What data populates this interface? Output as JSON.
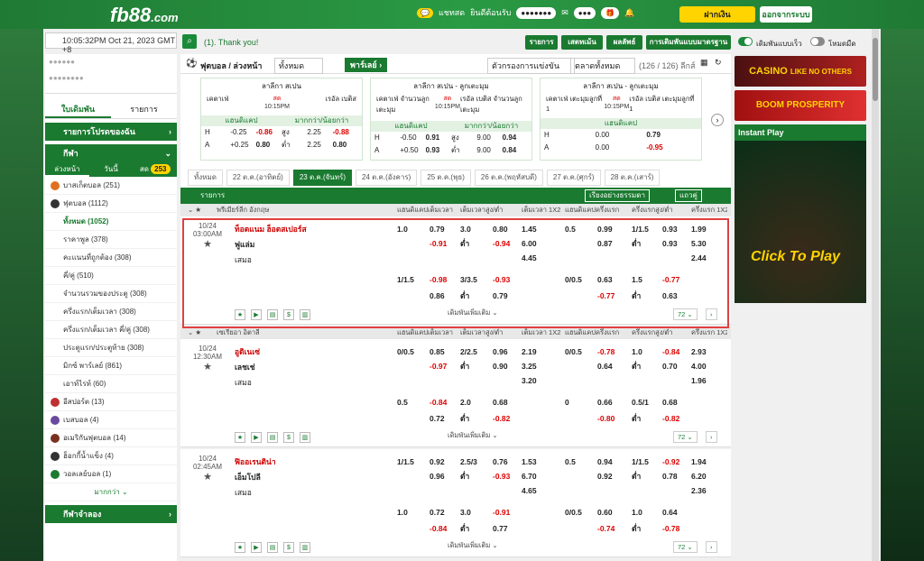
{
  "header": {
    "logo": "fb88",
    "logo_suffix": ".com",
    "chat": "แชทสด",
    "welcome": "ยินดีต้อนรับ",
    "deposit": "ฝากเงิน",
    "logout": "ออกจากระบบ"
  },
  "toolbar": {
    "datetime": "10:05:32PM Oct 21, 2023 GMT +8",
    "marquee": "(1). Thank you!",
    "results": "รายการ",
    "statement": "เสตทเม้น",
    "results2": "ผลลัพธ์",
    "prefs": "การเดิมพันแบบมาตรฐาน",
    "quick_bet": "เดิมพันแบบเร็ว",
    "dark": "โหมดมืด"
  },
  "sidebar": {
    "tab_bet": "ใบเดิมพัน",
    "tab_list": "รายการ",
    "favorites": "รายการโปรดของฉัน",
    "sports": "กีฬา",
    "sub_tabs": [
      "ล่วงหน้า",
      "วันนี้",
      "สด"
    ],
    "live_count": "253",
    "items": [
      {
        "label": "บาสเก็ตบอล",
        "count": "(251)",
        "icon": "basketball-icon"
      },
      {
        "label": "ฟุตบอล",
        "count": "(1112)",
        "icon": "soccer-icon"
      }
    ],
    "soccer_sub": [
      {
        "label": "ทั้งหมด",
        "count": "(1052)"
      },
      {
        "label": "ราคาพูล",
        "count": "(378)"
      },
      {
        "label": "คะแนนที่ถูกต้อง",
        "count": "(308)"
      },
      {
        "label": "คี่/คู่",
        "count": "(510)"
      },
      {
        "label": "จำนวนรวมของประตู",
        "count": "(308)"
      },
      {
        "label": "ครึ่งแรก/เต็มเวลา",
        "count": "(308)"
      },
      {
        "label": "ครึ่งแรก/เต็มเวลา คี่/คู่",
        "count": "(308)"
      },
      {
        "label": "ประตูแรก/ประตูท้าย",
        "count": "(308)"
      },
      {
        "label": "มิกซ์ พาร์เลย์",
        "count": "(861)"
      },
      {
        "label": "เอาท์ไรท์",
        "count": "(60)"
      }
    ],
    "others": [
      {
        "label": "อีสปอร์ต",
        "count": "(13)",
        "icon": "esports-icon"
      },
      {
        "label": "เบสบอล",
        "count": "(4)",
        "icon": "baseball-icon"
      },
      {
        "label": "อเมริกันฟุตบอล",
        "count": "(14)",
        "icon": "american-football-icon"
      },
      {
        "label": "ฮ็อกกี้น้ำแข็ง",
        "count": "(4)",
        "icon": "ice-hockey-icon"
      },
      {
        "label": "วอลเลย์บอล",
        "count": "(1)",
        "icon": "volleyball-icon"
      }
    ],
    "more": "มากกว่า",
    "virtual": "กีฬาจำลอง"
  },
  "center": {
    "title": "ฟุตบอล / ล่วงหน้า",
    "filter": "ทั้งหมด",
    "parlay": "พาร์เลย์",
    "league_filter": "ตัวกรองการแข่งขัน",
    "market": "ตลาดทั้งหมด",
    "count": "(126 / 126) ลีกส์",
    "featured": [
      {
        "league": "ลาลีกา สเปน",
        "home": "เคตาเฟ่",
        "away": "เรอัล เบติส",
        "status": "สด",
        "time": "10:15PM",
        "m1": "แฮนดิแคป",
        "m2": "มากกว่า/น้อยกว่า",
        "rows": [
          {
            "a": "H",
            "b": "-0.25",
            "c": "-0.86",
            "d": "สูง",
            "e": "2.25",
            "f": "-0.88"
          },
          {
            "a": "A",
            "b": "+0.25",
            "c": "0.80",
            "d": "ต่ำ",
            "e": "2.25",
            "f": "0.80"
          }
        ]
      },
      {
        "league": "ลาลีกา สเปน - ลูกเตะมุม",
        "home": "เคตาเฟ่ จำนวนลูกเตะมุม",
        "away": "เรอัล เบติส จำนวนลูกเตะมุม",
        "status": "สด",
        "time": "10:15PM",
        "m1": "แฮนดิแคป",
        "m2": "มากกว่า/น้อยกว่า",
        "rows": [
          {
            "a": "H",
            "b": "-0.50",
            "c": "0.91",
            "d": "สูง",
            "e": "9.00",
            "f": "0.94"
          },
          {
            "a": "A",
            "b": "+0.50",
            "c": "0.93",
            "d": "ต่ำ",
            "e": "9.00",
            "f": "0.84"
          }
        ]
      },
      {
        "league": "ลาลีกา สเปน - ลูกเตะมุม",
        "home": "เคตาเฟ่ เตะมุมลูกที่ 1",
        "away": "เรอัล เบติส เตะมุมลูกที่ 1",
        "status": "สด",
        "time": "10:15PM",
        "m1": "แฮนดิแคป",
        "rows": [
          {
            "a": "H",
            "b": "0.00",
            "c": "0.79"
          },
          {
            "a": "A",
            "b": "0.00",
            "c": "-0.95"
          }
        ]
      }
    ],
    "dates": [
      "ทั้งหมด",
      "22 ต.ค.(อาทิตย์)",
      "23 ต.ค.(จันทร์)",
      "24 ต.ค.(อังคาร)",
      "25 ต.ค.(พุธ)",
      "26 ต.ค.(พฤหัสบดี)",
      "27 ต.ค.(ศุกร์)",
      "28 ต.ค.(เสาร์)"
    ],
    "list_label": "รายการ",
    "sort": "เรียงอย่างธรรมดา",
    "view": "แถวคู่",
    "columns": [
      "แฮนดิแคปเต็มเวลา",
      "เต็มเวลาสูง/ต่ำ",
      "เต็มเวลา 1X2",
      "แฮนดิแคปครึ่งแรก",
      "ครึ่งแรกสูง/ต่ำ",
      "ครึ่งแรก 1X2"
    ],
    "leagues": [
      {
        "name": "พรีเมียร์ลีก อังกฤษ",
        "matches": [
          {
            "date": "10/24",
            "time": "03:00AM",
            "home": "ท็อตแนม ฮ็อตสเปอร์ส",
            "away": "ฟูแล่ม",
            "draw": "เสมอ",
            "more": "เดิมพันเพิ่มเติม",
            "pages": "72",
            "r1": [
              "1.0",
              "0.79",
              "3.0",
              "0.80",
              "1.45",
              "0.5",
              "0.99",
              "1/1.5",
              "0.93",
              "1.99"
            ],
            "r2": [
              "",
              "-0.91",
              "ต่ำ",
              "-0.94",
              "6.00",
              "",
              "0.87",
              "ต่ำ",
              "0.93",
              "5.30"
            ],
            "r3": [
              "",
              "",
              "",
              "",
              "4.45",
              "",
              "",
              "",
              "",
              "2.44"
            ],
            "r4": [
              "1/1.5",
              "-0.98",
              "3/3.5",
              "-0.93",
              "",
              "0/0.5",
              "0.63",
              "1.5",
              "-0.77",
              ""
            ],
            "r5": [
              "",
              "0.86",
              "ต่ำ",
              "0.79",
              "",
              "",
              "-0.77",
              "ต่ำ",
              "0.63",
              ""
            ]
          }
        ]
      },
      {
        "name": "เซเรียอา อิตาลี",
        "matches": [
          {
            "date": "10/24",
            "time": "12:30AM",
            "home": "อูดิเนเซ่",
            "away": "เลชเช่",
            "draw": "เสมอ",
            "more": "เดิมพันเพิ่มเติม",
            "pages": "72",
            "r1": [
              "0/0.5",
              "0.85",
              "2/2.5",
              "0.96",
              "2.19",
              "0/0.5",
              "-0.78",
              "1.0",
              "-0.84",
              "2.93"
            ],
            "r2": [
              "",
              "-0.97",
              "ต่ำ",
              "0.90",
              "3.25",
              "",
              "0.64",
              "ต่ำ",
              "0.70",
              "4.00"
            ],
            "r3": [
              "",
              "",
              "",
              "",
              "3.20",
              "",
              "",
              "",
              "",
              "1.96"
            ],
            "r4": [
              "0.5",
              "-0.84",
              "2.0",
              "0.68",
              "",
              "0",
              "0.66",
              "0.5/1",
              "0.68",
              ""
            ],
            "r5": [
              "",
              "0.72",
              "ต่ำ",
              "-0.82",
              "",
              "",
              "-0.80",
              "ต่ำ",
              "-0.82",
              ""
            ]
          },
          {
            "date": "10/24",
            "time": "02:45AM",
            "home": "ฟิออเรนติน่า",
            "away": "เอ็มโปลี",
            "draw": "เสมอ",
            "more": "เดิมพันเพิ่มเติม",
            "pages": "72",
            "r1": [
              "1/1.5",
              "0.92",
              "2.5/3",
              "0.76",
              "1.53",
              "0.5",
              "0.94",
              "1/1.5",
              "-0.92",
              "1.94"
            ],
            "r2": [
              "",
              "0.96",
              "ต่ำ",
              "-0.93",
              "6.70",
              "",
              "0.92",
              "ต่ำ",
              "0.78",
              "6.20"
            ],
            "r3": [
              "",
              "",
              "",
              "",
              "4.65",
              "",
              "",
              "",
              "",
              "2.36"
            ],
            "r4": [
              "1.0",
              "0.72",
              "3.0",
              "-0.91",
              "",
              "0/0.5",
              "0.60",
              "1.0",
              "0.64",
              ""
            ],
            "r5": [
              "",
              "-0.84",
              "ต่ำ",
              "0.77",
              "",
              "",
              "-0.74",
              "ต่ำ",
              "-0.78",
              ""
            ]
          }
        ]
      }
    ]
  },
  "right": {
    "casino_banner": "CASINO",
    "casino_sub": "LIKE NO OTHERS",
    "promo_banner": "BOOM PROSPERITY",
    "instant": "Instant Play",
    "click": "Click To Play"
  },
  "colors": {
    "brand": "#1a7a30",
    "accent": "#ffd400",
    "negative": "#d00000",
    "highlight": "#e04040"
  }
}
